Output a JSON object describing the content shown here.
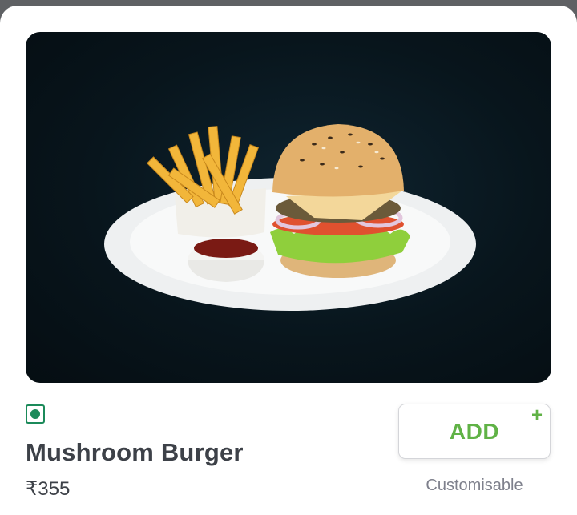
{
  "item": {
    "name": "Mushroom Burger",
    "price": "₹355",
    "diet_marker": "veg-icon",
    "image": "food-photo"
  },
  "actions": {
    "add_label": "ADD",
    "add_plus_symbol": "+",
    "customisable_note": "Customisable"
  },
  "colors": {
    "accent_green": "#60b246",
    "veg_green": "#1b8a5a",
    "title_text": "#3d4148",
    "muted_text": "#7e808c",
    "backdrop": "#5f6164"
  }
}
